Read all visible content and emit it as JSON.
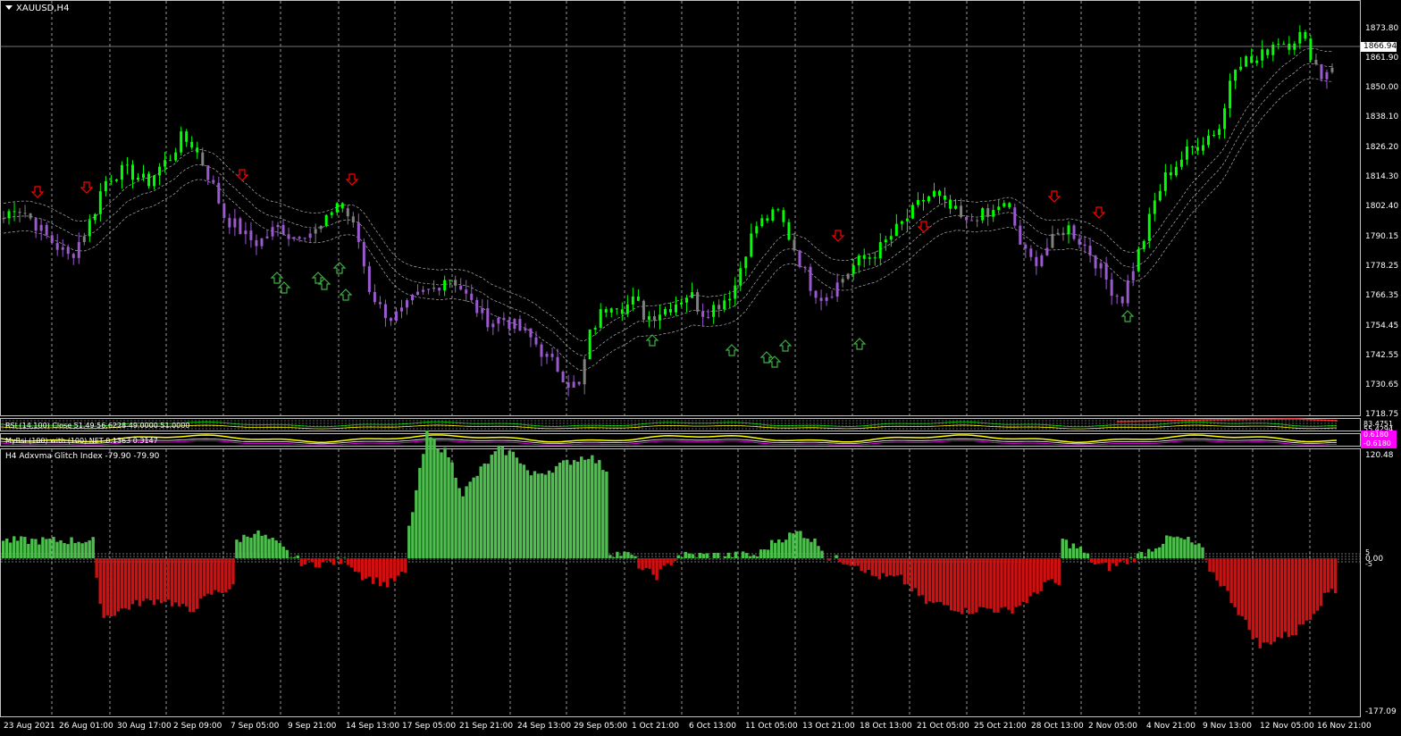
{
  "window": {
    "title": "XAUUSD,H4",
    "current_price": "1866.94"
  },
  "price_axis": {
    "labels": [
      "1873.80",
      "1861.90",
      "1850.00",
      "1838.10",
      "1826.20",
      "1814.30",
      "1802.40",
      "1790.15",
      "1778.25",
      "1766.35",
      "1754.45",
      "1742.55",
      "1730.65",
      "1718.75"
    ]
  },
  "time_axis": {
    "labels": [
      "23 Aug 2021",
      "26 Aug 01:00",
      "30 Aug 17:00",
      "2 Sep 09:00",
      "7 Sep 05:00",
      "9 Sep 21:00",
      "14 Sep 13:00",
      "17 Sep 05:00",
      "21 Sep 21:00",
      "24 Sep 13:00",
      "29 Sep 05:00",
      "1 Oct 21:00",
      "6 Oct 13:00",
      "11 Oct 05:00",
      "13 Oct 21:00",
      "18 Oct 13:00",
      "21 Oct 05:00",
      "25 Oct 21:00",
      "28 Oct 13:00",
      "2 Nov 05:00",
      "4 Nov 21:00",
      "9 Nov 13:00",
      "12 Nov 05:00",
      "16 Nov 21:00"
    ]
  },
  "rsi_panel": {
    "title": "RSI (14,100) Close 51.49 56.6228 49.0000 51.0000",
    "labels": [
      "83.4751",
      "55.4294"
    ]
  },
  "myrsi_panel": {
    "title": "MyRsi (100) with (100) NET 0.1363 0.3147",
    "label_top": "0.6180",
    "label_bottom": "-0.6180"
  },
  "glitch_panel": {
    "title": "H4 Adxvma Glitch Index -79.90 -79.90",
    "label_top": "120.48",
    "label_mid_1": "5",
    "label_mid_2": "0.00",
    "label_mid_3": "-5",
    "label_bottom": "-177.09"
  },
  "colors": {
    "bull_candle": "#00ff00",
    "bear_candle": "#9b59d0",
    "neutral_candle": "#808080",
    "histogram_positive": "#4cbf4c",
    "histogram_negative": "#d01010",
    "arrow_down": "#ff0000",
    "arrow_up": "#3cb043",
    "current_price_tag_bg": "#ffffff",
    "myrsi_tag_bg": "#ff00ff"
  },
  "chart_data": {
    "type": "candlestick",
    "symbol": "XAUUSD",
    "timeframe": "H4",
    "ylim": [
      1718.75,
      1880
    ],
    "close_path": [
      1798,
      1803,
      1800,
      1795,
      1790,
      1786,
      1782,
      1790,
      1798,
      1812,
      1816,
      1817,
      1815,
      1812,
      1818,
      1822,
      1830,
      1828,
      1820,
      1810,
      1798,
      1795,
      1790,
      1788,
      1792,
      1795,
      1790,
      1793,
      1792,
      1795,
      1805,
      1800,
      1790,
      1770,
      1762,
      1758,
      1760,
      1765,
      1768,
      1770,
      1775,
      1772,
      1765,
      1760,
      1756,
      1758,
      1755,
      1752,
      1748,
      1742,
      1738,
      1732,
      1730,
      1752,
      1760,
      1765,
      1762,
      1765,
      1758,
      1760,
      1762,
      1765,
      1768,
      1760,
      1762,
      1765,
      1770,
      1785,
      1795,
      1798,
      1800,
      1790,
      1780,
      1770,
      1766,
      1770,
      1775,
      1780,
      1782,
      1785,
      1790,
      1795,
      1800,
      1805,
      1808,
      1803,
      1800,
      1795,
      1800,
      1798,
      1804,
      1800,
      1785,
      1780,
      1785,
      1790,
      1795,
      1790,
      1785,
      1778,
      1770,
      1765,
      1778,
      1790,
      1805,
      1815,
      1820,
      1825,
      1828,
      1832,
      1835,
      1860,
      1862,
      1860,
      1865,
      1870,
      1868,
      1872,
      1865,
      1855,
      1860
    ]
  }
}
